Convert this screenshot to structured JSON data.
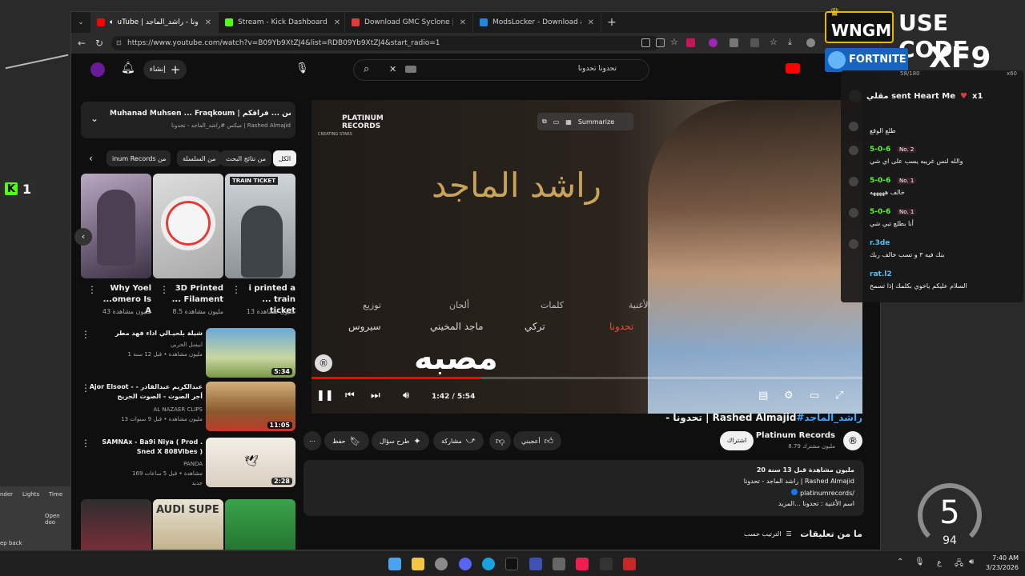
{
  "browser": {
    "tabs": [
      {
        "label": "uTube | تحدونا - راشد_الماجد#",
        "color": "#ff0000",
        "active": true
      },
      {
        "label": "Stream - Kick Dashboard",
        "color": "#53fc18",
        "active": false
      },
      {
        "label": "Download GMC Syclone | Assetto",
        "color": "#e53935",
        "active": false
      },
      {
        "label": "ModsLocker - Download asw-gmc",
        "color": "#1e88e5",
        "active": false
      }
    ],
    "new_tab": "+",
    "url": "https://www.youtube.com/watch?v=B09Yb9XtZJ4&list=RDB09Yb9XtZJ4&start_radio=1"
  },
  "youtube": {
    "search_value": "تحدونا تحدونا",
    "create_label": "إنشاء",
    "now_playing": {
      "title": "Muhanad Muhsen ... Fraqkoum | الحالي: ...د محسن ... فراقكم",
      "subtitle": "ميكس #راشد_الماجد - تحدونا | Rashed Almajid"
    },
    "chips": [
      "الكل",
      "من نتائج البحث",
      "من السلسلة",
      "inum Records من"
    ],
    "shorts": [
      {
        "title": "Why Yoel ...omero Is A",
        "views": "43 مليون مشاهدة"
      },
      {
        "title": "3D Printed ... Filament",
        "views": "8.5 مليون مشاهدة"
      },
      {
        "title": "i printed a ... train ticket",
        "views": "13 مليون مشاهدة"
      }
    ],
    "short_overlay": "TRAIN TICKET",
    "related": [
      {
        "title": "شيلة بلحيـالي اداء فهد مطر",
        "channel": "ابيسل الحربي",
        "meta": "1 مليون مشاهدة • قبل 12 سنة",
        "duration": "5:34"
      },
      {
        "title": "Ajor Elsoot - عبدالكريم عبدالقادر - أجر الصوت - الصوت الجريح",
        "channel": "AL NAZAER CLIPS",
        "meta": "13 مليون مشاهدة • قبل 9 سنوات",
        "duration": "11:05"
      },
      {
        "title": "SAMNAx - Ba9i Niya ( Prod . Sned X 808Vibes )",
        "channel": "PANDA",
        "meta": "169 مشاهدة • قبل 5 ساعات",
        "duration": "2:28",
        "tag": "جديد"
      }
    ],
    "bottom_thumb_text": "AUDI SUPE",
    "player": {
      "logo_line1": "PLATINUM",
      "logo_line2": "RECORDS",
      "logo_line3": "CREATING STARS",
      "summarize_label": "Summarize",
      "artist_calligraphy": "راشد الماجد",
      "credits": [
        {
          "label": "الأغنية",
          "value": "تحدونا"
        },
        {
          "label": "كلمات",
          "value": "تركي"
        },
        {
          "label": "ألحان",
          "value": "ماجد المخيني"
        },
        {
          "label": "توزيع",
          "value": "سيروس"
        }
      ],
      "time": "1:42 / 5:54",
      "progress": 0.308,
      "overlay_text": "مصبه"
    },
    "video_title_hashtag": "#راشد_الماجد",
    "video_title_rest": " - تحدونا | Rashed Almajid",
    "channel_name": "Platinum Records",
    "subscribers": "8.79 مليون مشترك",
    "subscribe_label": "اشتراك",
    "actions": {
      "like": "أعجبني",
      "ask": "طرح سؤال",
      "share": "مشاركة",
      "save": "حفظ"
    },
    "description": {
      "stats": "20 مليون مشاهدة قبل 13 سنة",
      "line1": "راشد الماجد - تحدونا | Rashed Almajid",
      "line2": "platinumrecords/",
      "line3": "اسم الأغنية : تحدونا ...المزيد"
    },
    "comments_label": "ما من تعليقات",
    "sort_label": "الترتيب حسب"
  },
  "overlay": {
    "promo_line1": "USE CODE",
    "promo_code": "XF9",
    "badge_text": "WNGM",
    "game_text": "FORTNITE",
    "kick_count": "1",
    "chat_header": "58/180",
    "chat_header_right": "x60",
    "gift_text": "مقلي sent Heart Me",
    "gift_multiplier": "x1",
    "messages": [
      {
        "name": "",
        "badge": "",
        "text": "طلع الوقع"
      },
      {
        "name": "5-0-6",
        "badge": "No. 2",
        "text": "والله لنس غريبه يسب على اي شي"
      },
      {
        "name": "5-0-6",
        "badge": "No. 1",
        "text": "خالف هههههه"
      },
      {
        "name": "5-0-6",
        "badge": "No. 1",
        "text": "أنا بطلع تبي شي"
      },
      {
        "name": "r.3de",
        "badge": "",
        "text": "بنك فيه ٣ و تسب خالف ربك"
      },
      {
        "name": "rat.l2",
        "badge": "",
        "text": "السلام عليكم ياخوي بكلمك إذا تسمح"
      }
    ],
    "speed_value": "5",
    "speed_sub": "94",
    "side_labels": [
      "nder",
      "Lights",
      "Time",
      "Open doo",
      "ep back"
    ]
  },
  "taskbar": {
    "time": "7:40 AM",
    "date": "3/23/2026",
    "lang": "ع"
  }
}
